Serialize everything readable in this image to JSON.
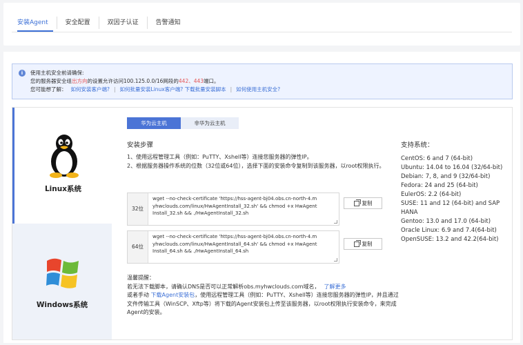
{
  "tabs": [
    {
      "label": "安装Agent",
      "active": true
    },
    {
      "label": "安全配置",
      "active": false
    },
    {
      "label": "双因子认证",
      "active": false
    },
    {
      "label": "告警通知",
      "active": false
    }
  ],
  "notice": {
    "title": "使用主机安全前请确保:",
    "line2_prefix": "您的服务器安全组",
    "line2_red1": "出方向",
    "line2_mid": "的设置允许访问100.125.0.0/16网段的",
    "line2_red2": "442、443",
    "line2_suffix": "端口。",
    "line3_prefix": "您可能想了解：",
    "links": [
      "如何安装客户端?",
      "如何批量安装Linux客户端? 下载批量安装脚本",
      "如何使用主机安全?"
    ]
  },
  "os": {
    "linux": "Linux系统",
    "windows": "Windows系统"
  },
  "host_tabs": [
    {
      "label": "华为云主机",
      "active": true
    },
    {
      "label": "非华为云主机",
      "active": false
    }
  ],
  "steps": {
    "title": "安装步骤",
    "step1": "1、使用远程管理工具（例如：PuTTY、Xshell等）连接您服务器的弹性IP。",
    "step2": "2、根据服务器操作系统的位数（32位或64位），选择下面的安装命令复制到该服务器，以root权限执行。"
  },
  "commands": [
    {
      "bits": "32位",
      "cmd": "wget --no-check-certificate 'https://hss-agent-bj04.obs.cn-north-4.myhwclouds.com/linux/HwAgentInstall_32.sh' && chmod +x HwAgentInstall_32.sh && ./HwAgentInstall_32.sh",
      "copy": "复制"
    },
    {
      "bits": "64位",
      "cmd": "wget --no-check-certificate 'https://hss-agent-bj04.obs.cn-north-4.myhwclouds.com/linux/HwAgentInstall_64.sh' && chmod +x HwAgentInstall_64.sh && ./HwAgentInstall_64.sh",
      "copy": "复制"
    }
  ],
  "tip": {
    "title": "温馨提醒：",
    "line1": "若无法下载脚本，请确认DNS是否可以正常解析obs.myhwclouds.com域名，",
    "line1_link": "了解更多",
    "line2_prefix": "或者手动 ",
    "line2_link": "下载Agent安装包",
    "line2_rest": "，使用远程管理工具（例如：PuTTY、Xshell等）连接您服务器的弹性IP，并且通过文件传输工具（WinSCP、Xftp等）将下载的Agent安装包上传至该服务器，以root权限执行安装命令，来完成Agent的安装。"
  },
  "supported": {
    "title": "支持系统：",
    "items": [
      "CentOS: 6 and 7 (64-bit)",
      "Ubuntu: 14.04 to 16.04 (32/64-bit)",
      "Debian: 7, 8, and 9 (32/64-bit)",
      "Fedora: 24 and 25 (64-bit)",
      "EulerOS: 2.2 (64-bit)",
      "SUSE: 11 and 12 (64-bit) and SAP HANA",
      "Gentoo: 13.0 and 17.0 (64-bit)",
      "Oracle Linux: 6.9 and 7.4(64-bit)",
      "OpenSUSE: 13.2 and 42.2(64-bit)"
    ]
  },
  "colors": {
    "accent": "#4b74d6",
    "link": "#3b6fd6",
    "warn": "#e45353"
  }
}
